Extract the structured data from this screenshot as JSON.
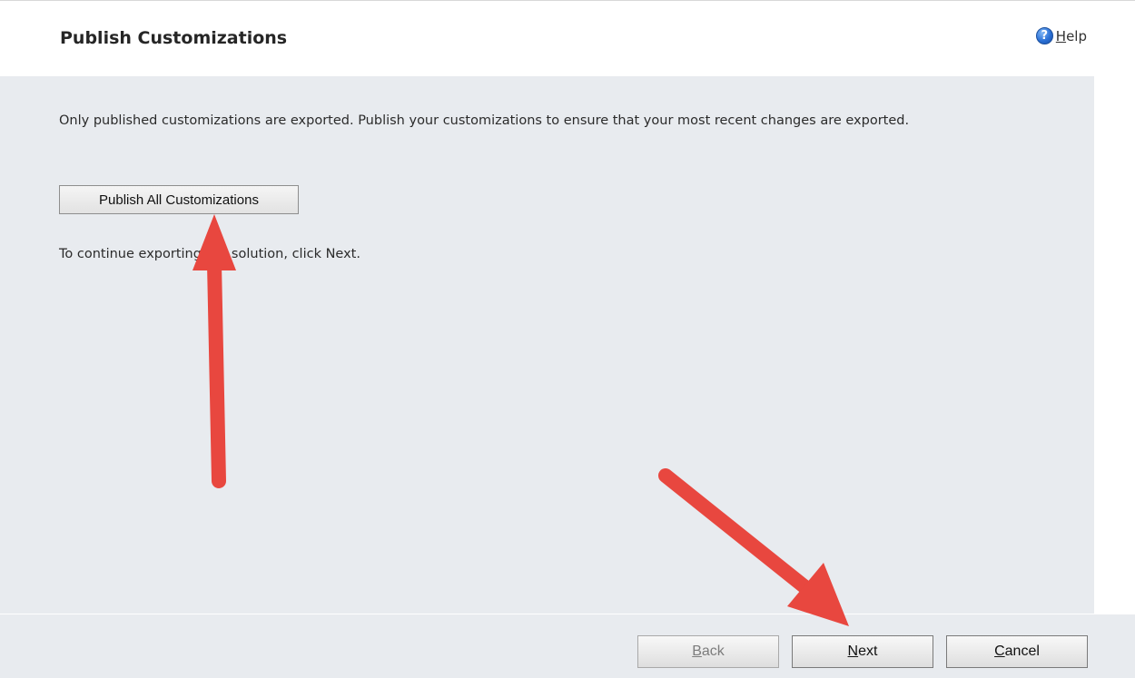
{
  "header": {
    "title": "Publish Customizations",
    "help_accesskey": "H",
    "help_rest": "elp"
  },
  "main": {
    "description": "Only published customizations are exported. Publish your customizations to ensure that your most recent changes are exported.",
    "publish_button_label": "Publish All Customizations",
    "continue_text": "To continue exporting the solution, click Next."
  },
  "footer": {
    "back": {
      "accesskey": "B",
      "rest": "ack"
    },
    "next": {
      "accesskey": "N",
      "rest": "ext"
    },
    "cancel": {
      "accesskey": "C",
      "rest": "ancel"
    }
  },
  "annotation": {
    "arrow_color": "#e8473f"
  },
  "colors": {
    "content_background": "#e8ebef",
    "help_icon": "#2a70d6"
  },
  "icons": {
    "help": "question-circle-icon"
  }
}
